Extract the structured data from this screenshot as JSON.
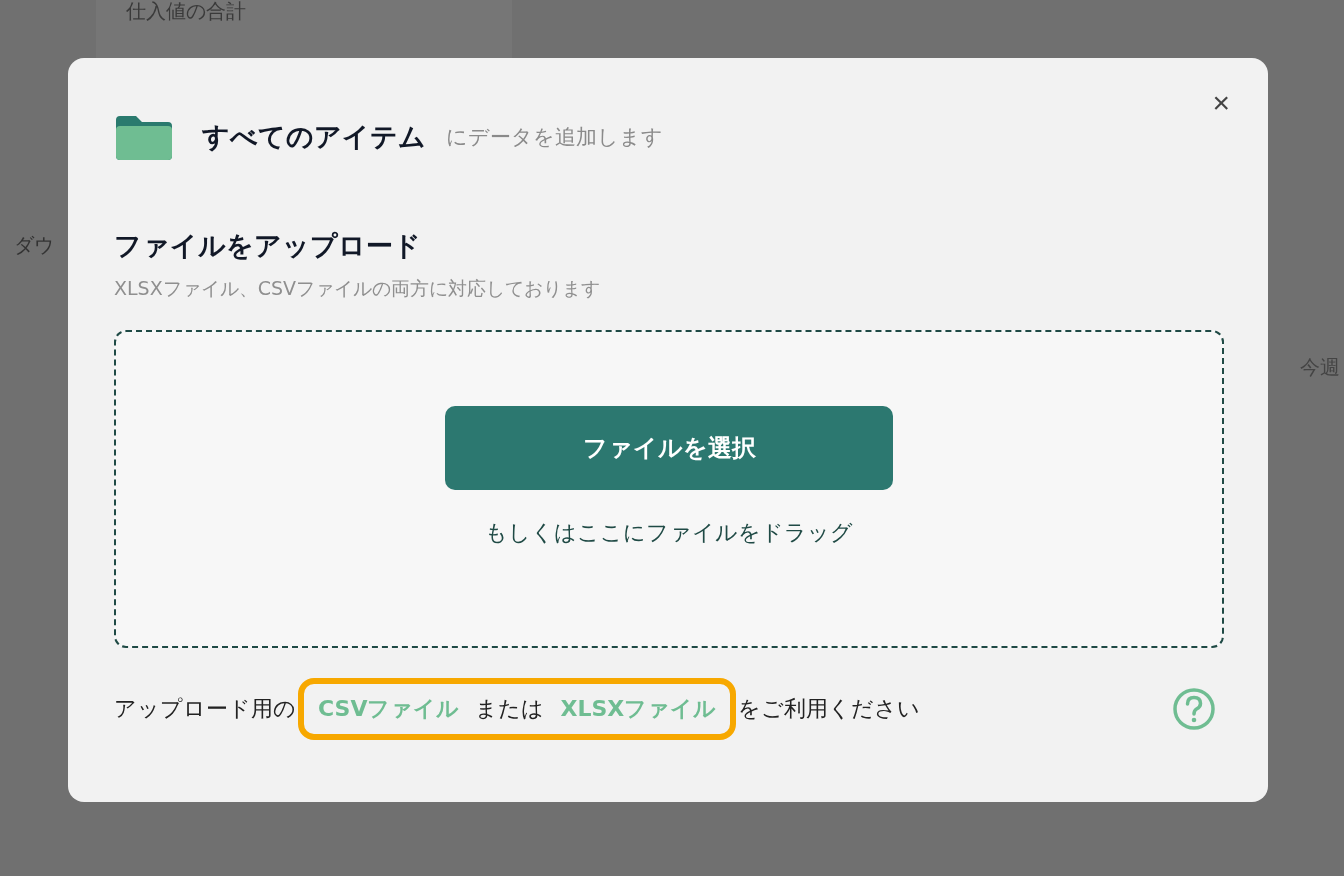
{
  "background": {
    "card_title": "仕入値の合計",
    "button_label": "ダウ",
    "tab_label": "今週"
  },
  "dialog": {
    "destination": "すべてのアイテム",
    "destination_suffix": "にデータを追加します",
    "close": "×",
    "upload_title": "ファイルをアップロード",
    "upload_subtitle": "XLSXファイル、CSVファイルの両方に対応しております",
    "select_button": "ファイルを選択",
    "drag_hint": "もしくはここにファイルをドラッグ",
    "footer": {
      "prefix": "アップロード用の",
      "links": [
        "CSVファイル",
        "XLSXファイル"
      ],
      "joiner": "または",
      "suffix": "をご利用ください",
      "highlighted": true
    }
  }
}
